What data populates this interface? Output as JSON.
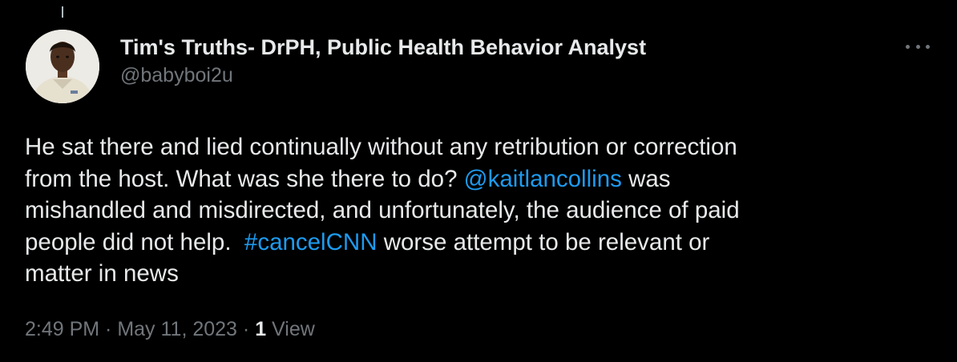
{
  "colors": {
    "background": "#000000",
    "primary_text": "#e7e9ea",
    "secondary_text": "#71767b",
    "link": "#1d9bf0"
  },
  "author": {
    "display_name": "Tim's Truths- DrPH, Public Health Behavior Analyst",
    "handle": "@babyboi2u",
    "avatar_icon": "profile-photo"
  },
  "more_icon": "more-horizontal-icon",
  "tweet": {
    "text_1": "He sat there and lied continually without any retribution or correction\nfrom the host. What was she there to do? ",
    "mention": "@kaitlancollins",
    "text_2": " was\nmishandled and misdirected, and unfortunately, the audience of paid\npeople did not help.  ",
    "hashtag": "#cancelCNN",
    "text_3": " worse attempt to be relevant or\nmatter in news"
  },
  "meta": {
    "time": "2:49 PM",
    "separator": " · ",
    "date": "May 11, 2023",
    "views_count": "1",
    "views_label": " View"
  }
}
